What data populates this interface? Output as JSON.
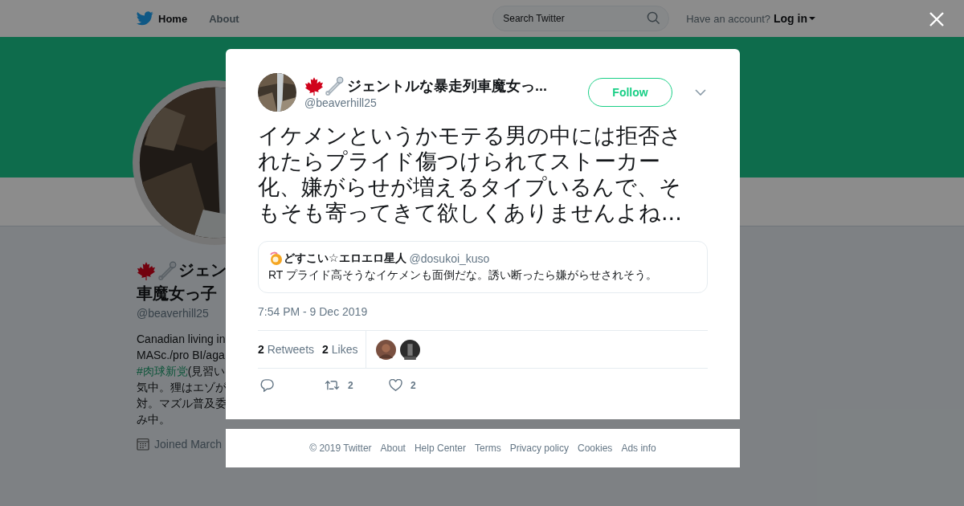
{
  "topbar": {
    "nav": [
      {
        "label": "Home",
        "selected": true
      },
      {
        "label": "About",
        "selected": false
      }
    ],
    "search": {
      "placeholder": "Search Twitter"
    },
    "account_prompt": "Have an account?",
    "login": "Log in"
  },
  "profile": {
    "name_lines": [
      "ジェン",
      "車魔女っ子"
    ],
    "handle": "@beaverhill25",
    "bio_lines": [
      {
        "kind": "text",
        "text": "Canadian living in"
      },
      {
        "kind": "text",
        "text": "MASc./pro BI/aga"
      },
      {
        "kind": "hashtag",
        "text": "#肉球新党",
        "rest": "(見習い"
      },
      {
        "kind": "text",
        "text": "気中。狸はエゾが"
      },
      {
        "kind": "text",
        "text": "対。マズル普及委"
      },
      {
        "kind": "text",
        "text": "み中。"
      }
    ],
    "joined": "Joined March"
  },
  "tweet": {
    "author": {
      "name": "ジェントルな暴走列車魔女っ...",
      "handle": "@beaverhill25"
    },
    "follow": "Follow",
    "text": "イケメンというかモテる男の中には拒否されたらプライド傷つけられてストーカー化、嫌がらせが増えるタイプいるんで、そもそも寄ってきて欲しくありませんよね...",
    "quoted": {
      "name": "どすこい☆エロエロ星人",
      "handle": "@dosukoi_kuso",
      "text": "RT プライド高そうなイケメンも面倒だな。誘い断ったら嫌がらせされそう。"
    },
    "timestamp": "7:54 PM - 9 Dec 2019",
    "stats": [
      {
        "count": "2",
        "label": "Retweets"
      },
      {
        "count": "2",
        "label": "Likes"
      }
    ],
    "actions": [
      {
        "kind": "reply"
      },
      {
        "kind": "retweet",
        "count": "2"
      },
      {
        "kind": "like",
        "count": "2"
      }
    ]
  },
  "footer": [
    "© 2019 Twitter",
    "About",
    "Help Center",
    "Terms",
    "Privacy policy",
    "Cookies",
    "Ads info"
  ]
}
